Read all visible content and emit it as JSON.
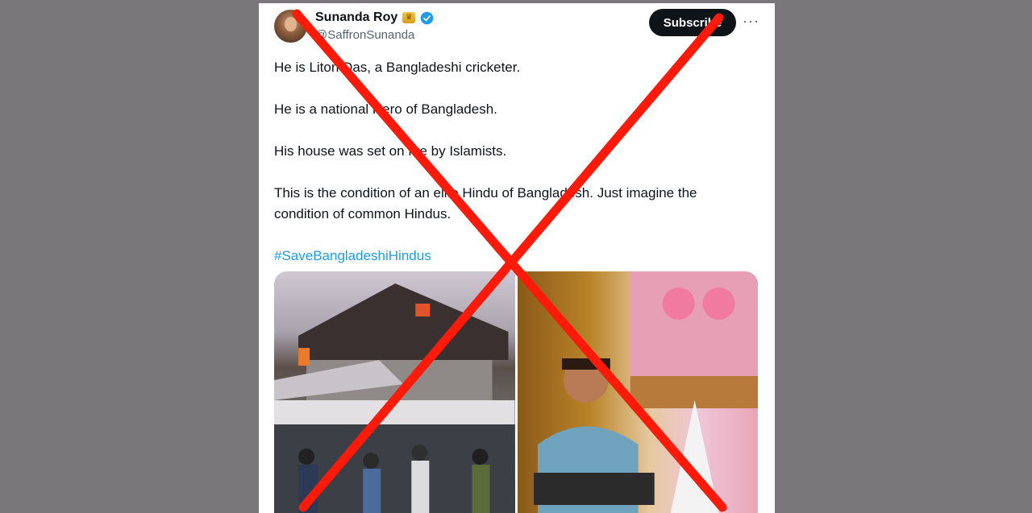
{
  "tweet": {
    "display_name": "Sunanda Roy",
    "handle": "@SaffronSunanda",
    "subscribe_label": "Subscribe",
    "more_label": "···",
    "paragraphs": [
      "He is Liton Das, a Bangladeshi cricketer.",
      "He is a national Hero of Bangladesh.",
      "His house was set on fire by Islamists.",
      "This is the condition of an elite Hindu of Bangladesh. Just imagine the condition of common Hindus."
    ],
    "hashtag": "#SaveBangladeshiHindus"
  },
  "colors": {
    "background": "#7a777b",
    "cross": "#ff1a0a",
    "verified": "#1d9bf0",
    "hashtag": "#1d9bf0"
  },
  "icons": {
    "verified": "verified-badge-icon",
    "gold_badge": "gold-badge-icon",
    "more": "more-options-icon"
  }
}
